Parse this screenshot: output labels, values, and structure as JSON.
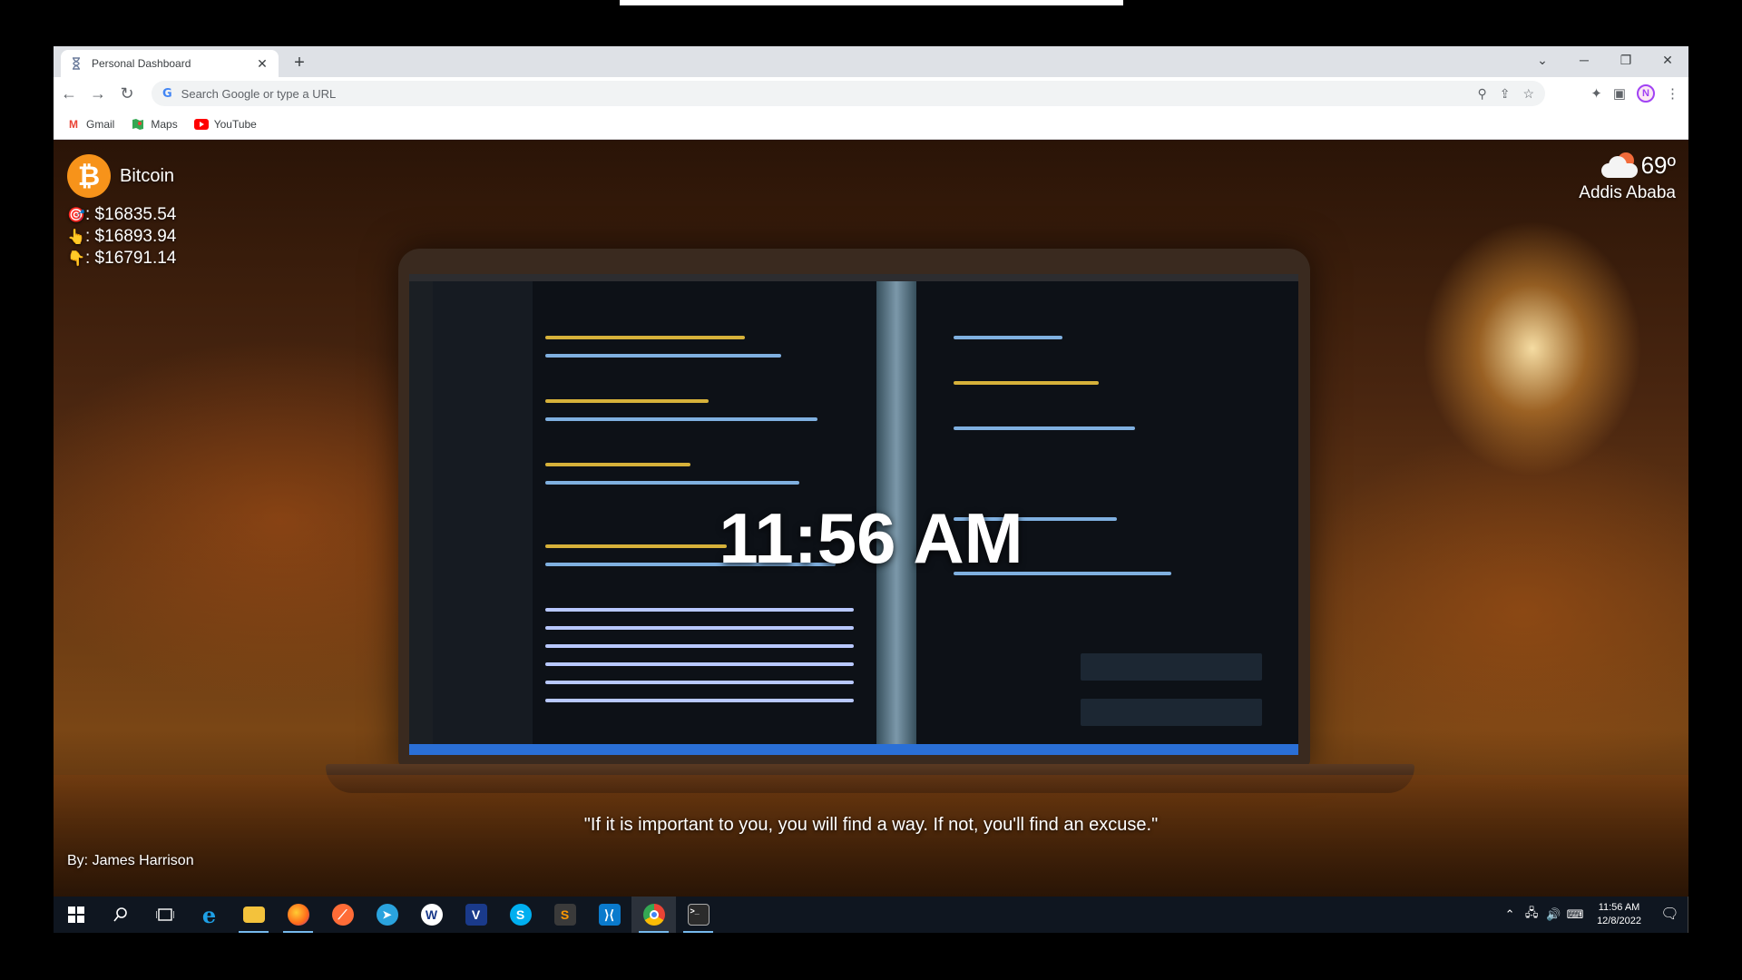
{
  "browser": {
    "tab_title": "Personal Dashboard",
    "tab_close": "✕",
    "new_tab": "+",
    "omnibox_placeholder": "Search Google or type a URL",
    "avatar_letter": "N",
    "bookmarks": [
      {
        "label": "Gmail",
        "icon": "gmail-icon",
        "color": "#ea4335"
      },
      {
        "label": "Maps",
        "icon": "maps-icon",
        "color": "#34a853"
      },
      {
        "label": "YouTube",
        "icon": "youtube-icon",
        "color": "#ff0000"
      }
    ]
  },
  "dashboard": {
    "crypto": {
      "name": "Bitcoin",
      "current_label": ": $16835.54",
      "high_label": ": $16893.94",
      "low_label": ": $16791.14",
      "brand_color": "#f7931a"
    },
    "weather": {
      "temp": "69º",
      "city": "Addis Ababa"
    },
    "time": "11:56 AM",
    "quote": "\"If it is important to you, you will find a way. If not, you'll find an excuse.\"",
    "author": "By: James Harrison"
  },
  "taskbar": {
    "apps": [
      {
        "name": "internet-explorer",
        "letter": "e",
        "color": "#1ea0e6"
      },
      {
        "name": "file-explorer",
        "letter": "",
        "color": "#f3c23c"
      },
      {
        "name": "firefox",
        "letter": "",
        "color": "#ff6a1a"
      },
      {
        "name": "postman",
        "letter": "",
        "color": "#ff6c37"
      },
      {
        "name": "telegram",
        "letter": "",
        "color": "#2aa3de"
      },
      {
        "name": "word-app",
        "letter": "W",
        "color": "#ffffff"
      },
      {
        "name": "vim-app",
        "letter": "V",
        "color": "#1a3a8a"
      },
      {
        "name": "skype",
        "letter": "S",
        "color": "#00aff0"
      },
      {
        "name": "sublime-text",
        "letter": "S",
        "color": "#3a3a3a"
      },
      {
        "name": "vscode",
        "letter": "",
        "color": "#0a7acc"
      },
      {
        "name": "chrome",
        "letter": "",
        "color": "#4285f4"
      },
      {
        "name": "terminal",
        "letter": ">_",
        "color": "#2b2b2b"
      }
    ],
    "clock_time": "11:56 AM",
    "clock_date": "12/8/2022"
  }
}
